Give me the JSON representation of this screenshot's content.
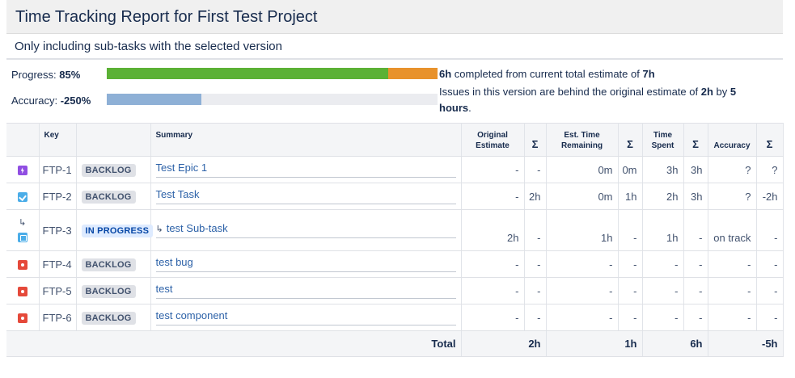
{
  "header": {
    "title": "Time Tracking Report for First Test Project",
    "subtitle": "Only including sub-tasks with the selected version"
  },
  "progress": {
    "label": "Progress",
    "value": "85%",
    "completed_fraction": 0.85,
    "remaining_fraction": 0.15,
    "text_hours": "6h",
    "text_middle": "completed from current total estimate of",
    "text_total": "7h",
    "colors": {
      "completed": "#5bb135",
      "remaining": "#e8922c"
    }
  },
  "accuracy": {
    "label": "Accuracy",
    "value": "-250%",
    "bar_fraction": 0.285,
    "text_part1": "Issues in this version are behind the original estimate of",
    "text_est": "2h",
    "text_by": "by",
    "text_num": "5",
    "text_unit": "hours",
    "color": "#8eb0d6"
  },
  "table": {
    "headers": {
      "key": "Key",
      "summary": "Summary",
      "original_1": "Original",
      "original_2": "Estimate",
      "est_1": "Est. Time",
      "est_2": "Remaining",
      "spent_1": "Time",
      "spent_2": "Spent",
      "accuracy": "Accuracy",
      "sigma": "Σ"
    },
    "rows": [
      {
        "icon": "epic-icon",
        "key": "FTP-1",
        "status": "BACKLOG",
        "summary": "Test Epic 1",
        "orig": "-",
        "orig_sum": "-",
        "rem": "0m",
        "rem_sum": "0m",
        "spent": "3h",
        "spent_sum": "3h",
        "acc": "?",
        "acc_sum": "?"
      },
      {
        "icon": "task-icon",
        "key": "FTP-2",
        "status": "BACKLOG",
        "summary": "Test Task",
        "orig": "-",
        "orig_sum": "2h",
        "rem": "0m",
        "rem_sum": "1h",
        "spent": "2h",
        "spent_sum": "3h",
        "acc": "?",
        "acc_sum": "-2h"
      },
      {
        "icon": "subtask-icon",
        "key": "FTP-3",
        "status": "IN PROGRESS",
        "summary": "test Sub-task",
        "orig": "2h",
        "orig_sum": "-",
        "rem": "1h",
        "rem_sum": "-",
        "spent": "1h",
        "spent_sum": "-",
        "acc": "on track",
        "acc_sum": "-"
      },
      {
        "icon": "bug-icon",
        "key": "FTP-4",
        "status": "BACKLOG",
        "summary": "test bug",
        "orig": "-",
        "orig_sum": "-",
        "rem": "-",
        "rem_sum": "-",
        "spent": "-",
        "spent_sum": "-",
        "acc": "-",
        "acc_sum": "-"
      },
      {
        "icon": "bug-icon",
        "key": "FTP-5",
        "status": "BACKLOG",
        "summary": "test",
        "orig": "-",
        "orig_sum": "-",
        "rem": "-",
        "rem_sum": "-",
        "spent": "-",
        "spent_sum": "-",
        "acc": "-",
        "acc_sum": "-"
      },
      {
        "icon": "bug-icon",
        "key": "FTP-6",
        "status": "BACKLOG",
        "summary": "test component",
        "orig": "-",
        "orig_sum": "-",
        "rem": "-",
        "rem_sum": "-",
        "spent": "-",
        "spent_sum": "-",
        "acc": "-",
        "acc_sum": "-"
      }
    ],
    "total": {
      "label": "Total",
      "orig": "2h",
      "rem": "1h",
      "spent": "6h",
      "acc": "-5h"
    }
  }
}
